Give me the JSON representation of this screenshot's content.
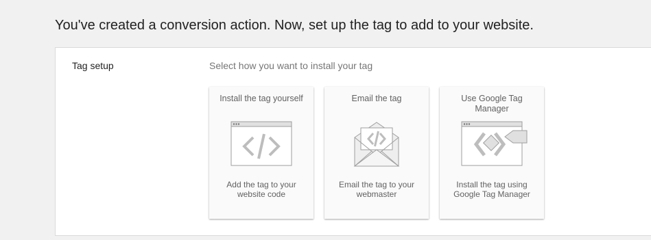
{
  "page": {
    "headline": "You've created a conversion action. Now, set up the tag to add to your website."
  },
  "tag_setup": {
    "label": "Tag setup",
    "instruction": "Select how you want to install your tag",
    "options": [
      {
        "title": "Install the tag yourself",
        "description": "Add the tag to your website code",
        "icon": "code-window-icon"
      },
      {
        "title": "Email the tag",
        "description": "Email the tag to your webmaster",
        "icon": "email-code-icon"
      },
      {
        "title": "Use Google Tag Manager",
        "description": "Install the tag using Google Tag Manager",
        "icon": "tag-manager-icon"
      }
    ]
  }
}
